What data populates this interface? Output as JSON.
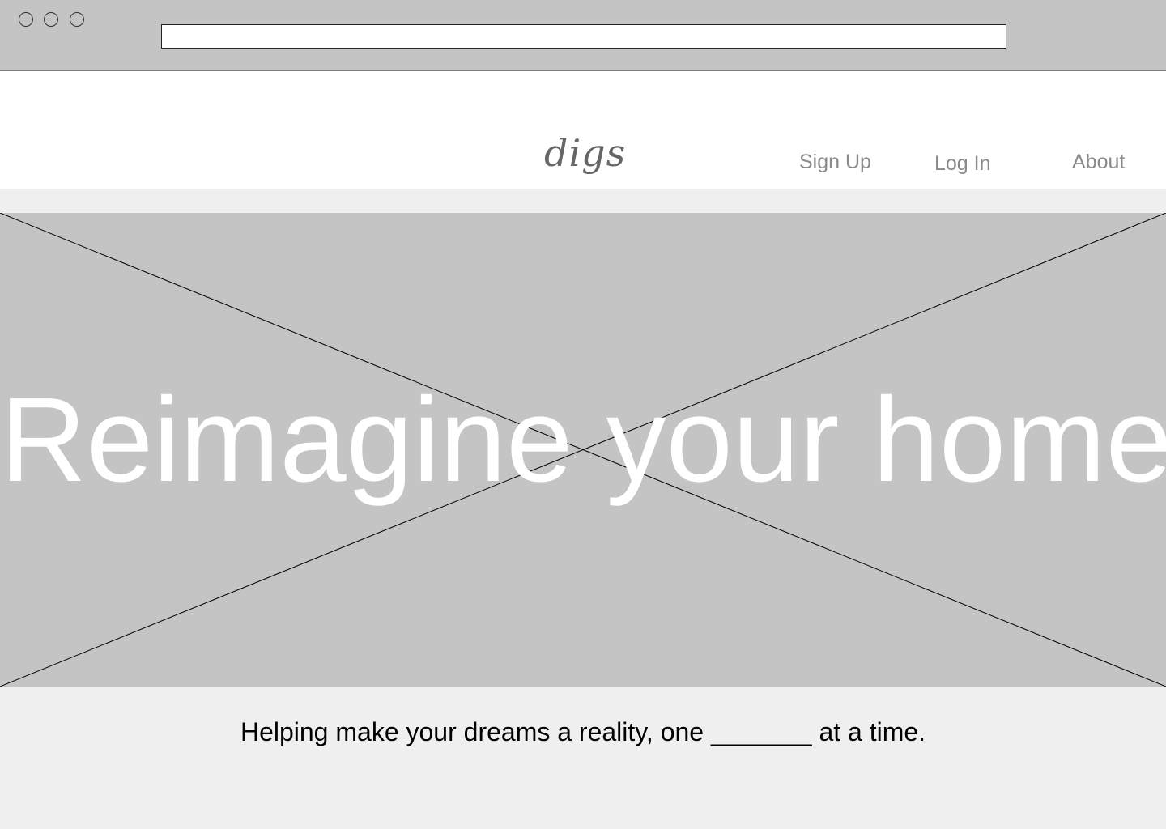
{
  "browser": {
    "window_buttons": [
      "close",
      "minimize",
      "maximize"
    ],
    "address_bar_value": ""
  },
  "header": {
    "logo": "digs",
    "nav": {
      "sign_up": "Sign Up",
      "log_in": "Log In",
      "about": "About"
    }
  },
  "hero": {
    "title": "Reimagine your home",
    "image_placeholder": "image-placeholder"
  },
  "tagline": "Helping make your dreams a reality, one _______ at a time.",
  "colors": {
    "chrome": "#c4c4c4",
    "page_background": "#efefef",
    "header_background": "#ffffff",
    "nav_text": "#8a8a8a",
    "logo_text": "#666666",
    "hero_placeholder": "#c4c4c4",
    "hero_text": "#ffffff"
  }
}
